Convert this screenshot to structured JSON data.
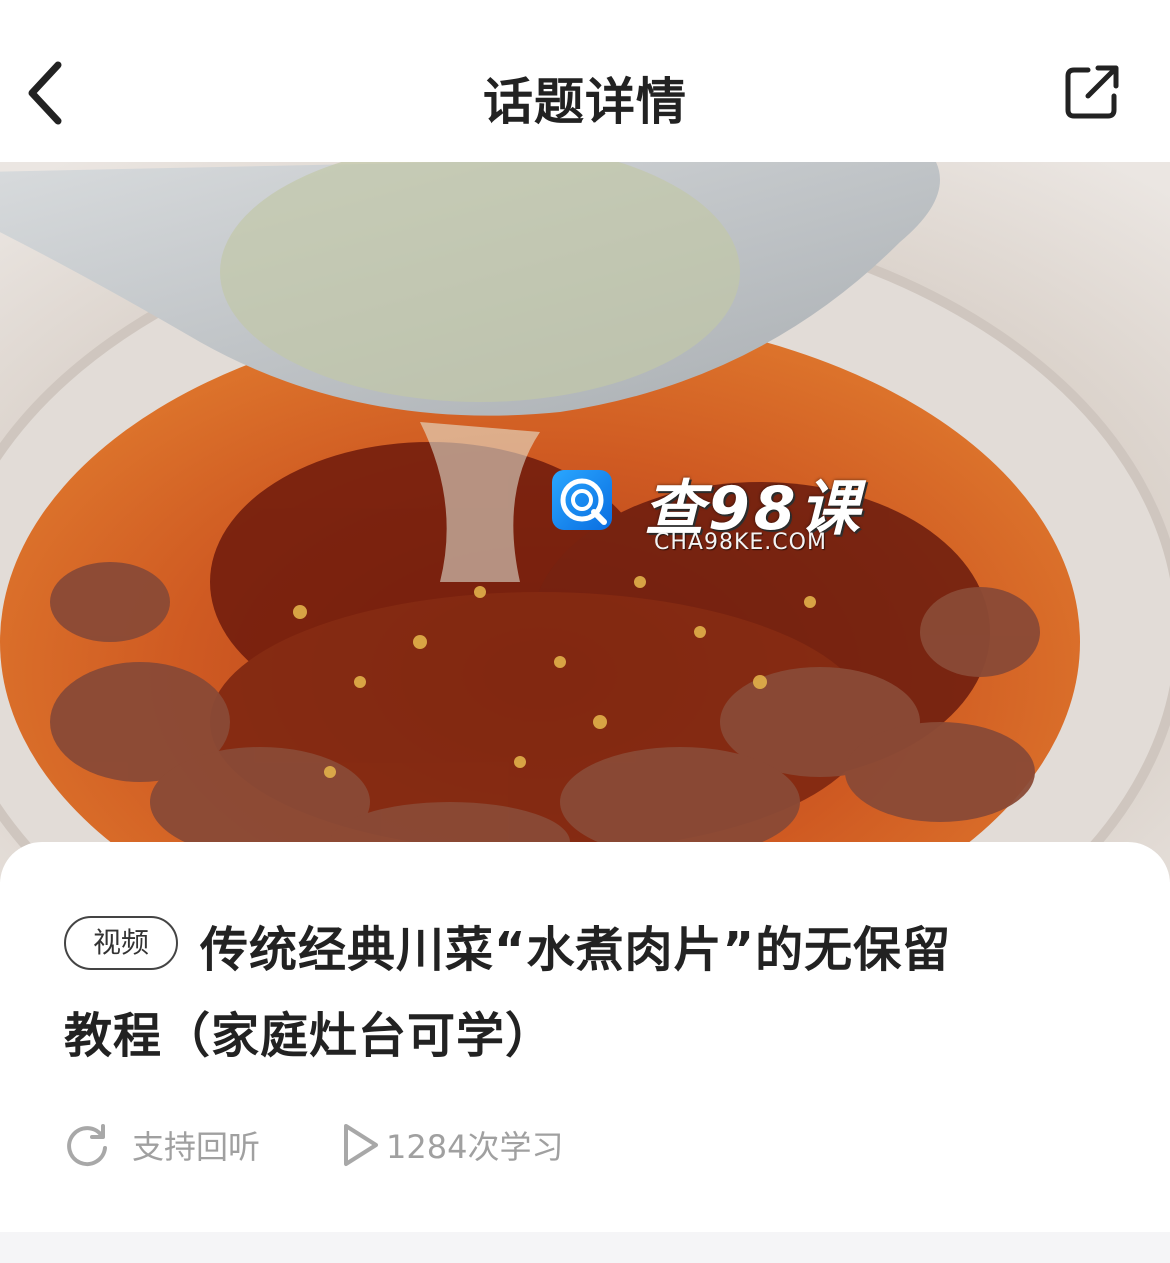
{
  "header": {
    "title": "话题详情",
    "back_icon": "chevron-left-icon",
    "share_icon": "share-external-icon"
  },
  "hero": {
    "watermark_text": "查98课",
    "watermark_sub": "CHA98KE.COM"
  },
  "content": {
    "tag": "视频",
    "title_line1": "传统经典川菜“水煮肉片”的无保留",
    "title_line2": "教程（家庭灶台可学）",
    "replay_label": "支持回听",
    "replay_icon": "refresh-icon",
    "views_label": "1284次学习",
    "play_icon": "play-icon"
  }
}
